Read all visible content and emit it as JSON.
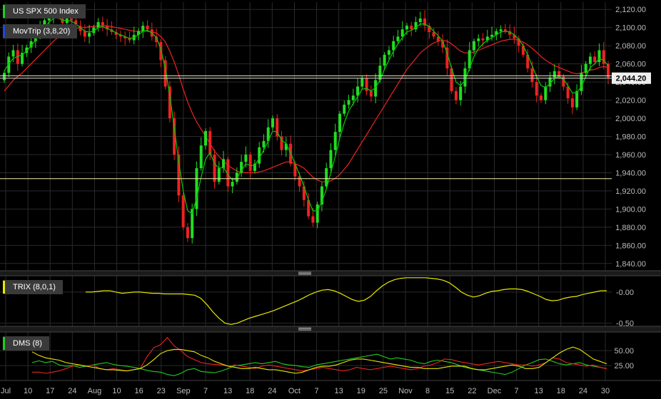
{
  "panes": {
    "price": {
      "labels": [
        {
          "text": "US SPX 500 Index",
          "color": "#22cc22"
        },
        {
          "text": "MovTrip (3,8,20)",
          "color": "#2244dd"
        }
      ],
      "y_ticks": [
        "2,120.00",
        "2,100.00",
        "2,080.00",
        "2,060.00",
        "2,040.00",
        "2,020.00",
        "2,000.00",
        "1,980.00",
        "1,960.00",
        "1,940.00",
        "1,920.00",
        "1,900.00",
        "1,880.00",
        "1,860.00",
        "1,840.00"
      ],
      "current_value_label": "2,044.20"
    },
    "trix": {
      "label": {
        "text": "TRIX (8,0,1)",
        "color": "#e8e800"
      },
      "y_ticks": [
        "-0.00",
        "-0.50"
      ]
    },
    "dms": {
      "label": {
        "text": "DMS (8)",
        "color": "#22cc22"
      },
      "y_ticks": [
        "50.00",
        "25.00"
      ]
    }
  },
  "x_axis": {
    "tick_labels": [
      "Jul",
      "10",
      "17",
      "24",
      "Aug",
      "10",
      "16",
      "23",
      "Sep",
      "7",
      "13",
      "18",
      "24",
      "Oct",
      "7",
      "13",
      "19",
      "25",
      "Nov",
      "8",
      "15",
      "22",
      "Dec",
      "7",
      "13",
      "18",
      "24",
      "30"
    ]
  },
  "colors": {
    "background": "#000000",
    "grid": "#2a2a2a",
    "up_candle": "#22dd22",
    "down_candle": "#ee2222",
    "ma_fast": "#00cc00",
    "ma_slow": "#ee2222",
    "trix": "#e8e800",
    "dms_plus": "#22cc22",
    "dms_minus": "#ee2222",
    "dms_adx": "#e8e800",
    "axis_text": "#bbbbbb"
  },
  "chart_data": [
    {
      "type": "candlestick",
      "title": "US SPX 500 Index",
      "ylim": [
        1832,
        2128
      ],
      "close": [
        2050,
        2068,
        2075,
        2060,
        2072,
        2078,
        2085,
        2090,
        2100,
        2108,
        2112,
        2118,
        2112,
        2105,
        2110,
        2108,
        2102,
        2096,
        2090,
        2094,
        2100,
        2106,
        2102,
        2098,
        2095,
        2092,
        2090,
        2088,
        2086,
        2092,
        2096,
        2102,
        2098,
        2090,
        2084,
        2064,
        2035,
        2000,
        1960,
        1915,
        1880,
        1868,
        1900,
        1945,
        1970,
        1986,
        1960,
        1930,
        1945,
        1955,
        1925,
        1930,
        1940,
        1952,
        1960,
        1942,
        1950,
        1968,
        1975,
        1990,
        2000,
        1980,
        1965,
        1972,
        1950,
        1936,
        1925,
        1910,
        1892,
        1885,
        1905,
        1925,
        1945,
        1965,
        1985,
        2005,
        2015,
        2020,
        2025,
        2035,
        2044,
        2030,
        2024,
        2042,
        2058,
        2070,
        2075,
        2085,
        2090,
        2098,
        2102,
        2098,
        2106,
        2110,
        2102,
        2095,
        2090,
        2085,
        2078,
        2055,
        2030,
        2020,
        2035,
        2055,
        2075,
        2085,
        2088,
        2086,
        2090,
        2092,
        2096,
        2098,
        2096,
        2092,
        2088,
        2080,
        2070,
        2055,
        2040,
        2025,
        2020,
        2035,
        2045,
        2052,
        2046,
        2035,
        2022,
        2012,
        2030,
        2050,
        2060,
        2068,
        2062,
        2075,
        2060,
        2045
      ],
      "ma_fast": [
        2052,
        2060,
        2066,
        2068,
        2070,
        2074,
        2080,
        2086,
        2094,
        2100,
        2106,
        2110,
        2111,
        2108,
        2108,
        2107,
        2104,
        2100,
        2096,
        2095,
        2096,
        2100,
        2101,
        2099,
        2097,
        2094,
        2092,
        2090,
        2088,
        2089,
        2092,
        2096,
        2097,
        2094,
        2089,
        2076,
        2055,
        2025,
        1990,
        1952,
        1920,
        1898,
        1895,
        1912,
        1935,
        1955,
        1962,
        1950,
        1945,
        1946,
        1938,
        1932,
        1934,
        1942,
        1950,
        1948,
        1948,
        1956,
        1965,
        1975,
        1986,
        1985,
        1976,
        1972,
        1962,
        1950,
        1938,
        1925,
        1910,
        1898,
        1898,
        1908,
        1922,
        1940,
        1958,
        1978,
        1995,
        2008,
        2016,
        2024,
        2032,
        2033,
        2030,
        2034,
        2042,
        2054,
        2064,
        2074,
        2082,
        2089,
        2095,
        2097,
        2100,
        2104,
        2104,
        2101,
        2096,
        2091,
        2085,
        2072,
        2055,
        2040,
        2036,
        2042,
        2055,
        2068,
        2077,
        2082,
        2086,
        2089,
        2092,
        2095,
        2096,
        2095,
        2092,
        2087,
        2080,
        2070,
        2058,
        2046,
        2036,
        2034,
        2038,
        2044,
        2046,
        2043,
        2036,
        2028,
        2028,
        2035,
        2046,
        2056,
        2060,
        2066,
        2064,
        2058
      ],
      "ma_slow": [
        2030,
        2036,
        2042,
        2046,
        2050,
        2055,
        2060,
        2065,
        2070,
        2075,
        2080,
        2085,
        2089,
        2092,
        2095,
        2097,
        2099,
        2100,
        2100,
        2101,
        2101,
        2102,
        2102,
        2102,
        2101,
        2100,
        2099,
        2098,
        2097,
        2096,
        2096,
        2096,
        2096,
        2095,
        2094,
        2090,
        2084,
        2074,
        2062,
        2048,
        2032,
        2018,
        2006,
        1996,
        1988,
        1980,
        1972,
        1964,
        1958,
        1953,
        1948,
        1945,
        1942,
        1940,
        1940,
        1940,
        1940,
        1941,
        1942,
        1944,
        1946,
        1948,
        1950,
        1952,
        1952,
        1950,
        1948,
        1945,
        1940,
        1935,
        1932,
        1930,
        1930,
        1931,
        1934,
        1938,
        1944,
        1950,
        1958,
        1966,
        1974,
        1982,
        1990,
        1998,
        2006,
        2014,
        2022,
        2030,
        2038,
        2046,
        2054,
        2060,
        2066,
        2072,
        2076,
        2080,
        2083,
        2085,
        2086,
        2085,
        2082,
        2078,
        2074,
        2072,
        2072,
        2073,
        2075,
        2077,
        2079,
        2081,
        2083,
        2085,
        2086,
        2087,
        2087,
        2086,
        2084,
        2081,
        2077,
        2073,
        2068,
        2064,
        2061,
        2058,
        2056,
        2054,
        2052,
        2050,
        2049,
        2050,
        2051,
        2053,
        2054,
        2056,
        2057,
        2056
      ]
    },
    {
      "type": "line",
      "title": "TRIX (8,0,1)",
      "ylim": [
        -0.55,
        0.25
      ],
      "series": [
        {
          "values": [
            0.0,
            0.0,
            0.01,
            0.02,
            0.02,
            0.0,
            -0.02,
            -0.01,
            0.0,
            0.0,
            -0.01,
            -0.02,
            -0.02,
            -0.03,
            -0.03,
            -0.03,
            -0.03,
            -0.04,
            -0.05,
            -0.1,
            -0.2,
            -0.32,
            -0.42,
            -0.5,
            -0.52,
            -0.5,
            -0.46,
            -0.42,
            -0.39,
            -0.36,
            -0.33,
            -0.3,
            -0.26,
            -0.22,
            -0.18,
            -0.14,
            -0.09,
            -0.04,
            0.0,
            0.03,
            0.04,
            0.02,
            -0.02,
            -0.07,
            -0.12,
            -0.15,
            -0.13,
            -0.07,
            0.02,
            0.1,
            0.16,
            0.2,
            0.22,
            0.23,
            0.23,
            0.23,
            0.23,
            0.22,
            0.21,
            0.19,
            0.15,
            0.08,
            0.0,
            -0.05,
            -0.08,
            -0.06,
            -0.02,
            0.01,
            0.02,
            0.04,
            0.05,
            0.05,
            0.04,
            0.01,
            -0.03,
            -0.07,
            -0.12,
            -0.14,
            -0.13,
            -0.1,
            -0.08,
            -0.07,
            -0.04,
            -0.02,
            0.0,
            0.02,
            0.02
          ]
        }
      ]
    },
    {
      "type": "line",
      "title": "DMS (8)",
      "ylim": [
        0,
        80
      ],
      "series": [
        {
          "values": [
            30,
            33,
            30,
            32,
            26,
            24,
            25,
            22,
            24,
            26,
            28,
            30,
            27,
            25,
            24,
            22,
            20,
            17,
            15,
            14,
            10,
            8,
            12,
            18,
            20,
            15,
            14,
            13,
            16,
            20,
            25,
            26,
            28,
            30,
            28,
            30,
            32,
            28,
            26,
            25,
            23,
            22,
            26,
            28,
            30,
            32,
            34,
            36,
            38,
            40,
            42,
            44,
            40,
            36,
            38,
            36,
            34,
            30,
            28,
            32,
            34,
            32,
            30,
            26,
            22,
            20,
            18,
            16,
            14,
            12,
            10,
            14,
            20,
            26,
            30,
            35,
            36,
            32,
            28,
            26,
            28,
            30,
            26,
            24,
            22,
            20
          ]
        },
        {
          "values": [
            14,
            14,
            12,
            14,
            16,
            20,
            24,
            26,
            24,
            26,
            20,
            18,
            20,
            18,
            16,
            18,
            20,
            40,
            55,
            60,
            72,
            58,
            50,
            40,
            35,
            30,
            28,
            27,
            26,
            24,
            26,
            24,
            22,
            20,
            24,
            26,
            24,
            22,
            20,
            18,
            16,
            18,
            20,
            22,
            20,
            18,
            16,
            18,
            22,
            20,
            18,
            20,
            22,
            24,
            22,
            20,
            18,
            20,
            24,
            26,
            30,
            36,
            35,
            32,
            30,
            28,
            26,
            28,
            30,
            32,
            30,
            28,
            26,
            26,
            24,
            26,
            30,
            38,
            36,
            30,
            28,
            26,
            24,
            26,
            22,
            20
          ]
        },
        {
          "values": [
            48,
            42,
            38,
            36,
            34,
            30,
            28,
            26,
            24,
            22,
            20,
            18,
            18,
            17,
            16,
            18,
            20,
            26,
            35,
            45,
            50,
            52,
            52,
            50,
            48,
            42,
            38,
            32,
            28,
            24,
            22,
            20,
            20,
            22,
            20,
            18,
            18,
            16,
            14,
            12,
            14,
            18,
            22,
            24,
            24,
            26,
            30,
            34,
            36,
            36,
            34,
            32,
            30,
            28,
            26,
            24,
            22,
            22,
            20,
            20,
            20,
            22,
            24,
            24,
            24,
            20,
            18,
            18,
            20,
            22,
            24,
            26,
            24,
            20,
            20,
            22,
            30,
            38,
            46,
            52,
            56,
            52,
            44,
            36,
            32,
            28
          ]
        }
      ]
    }
  ]
}
